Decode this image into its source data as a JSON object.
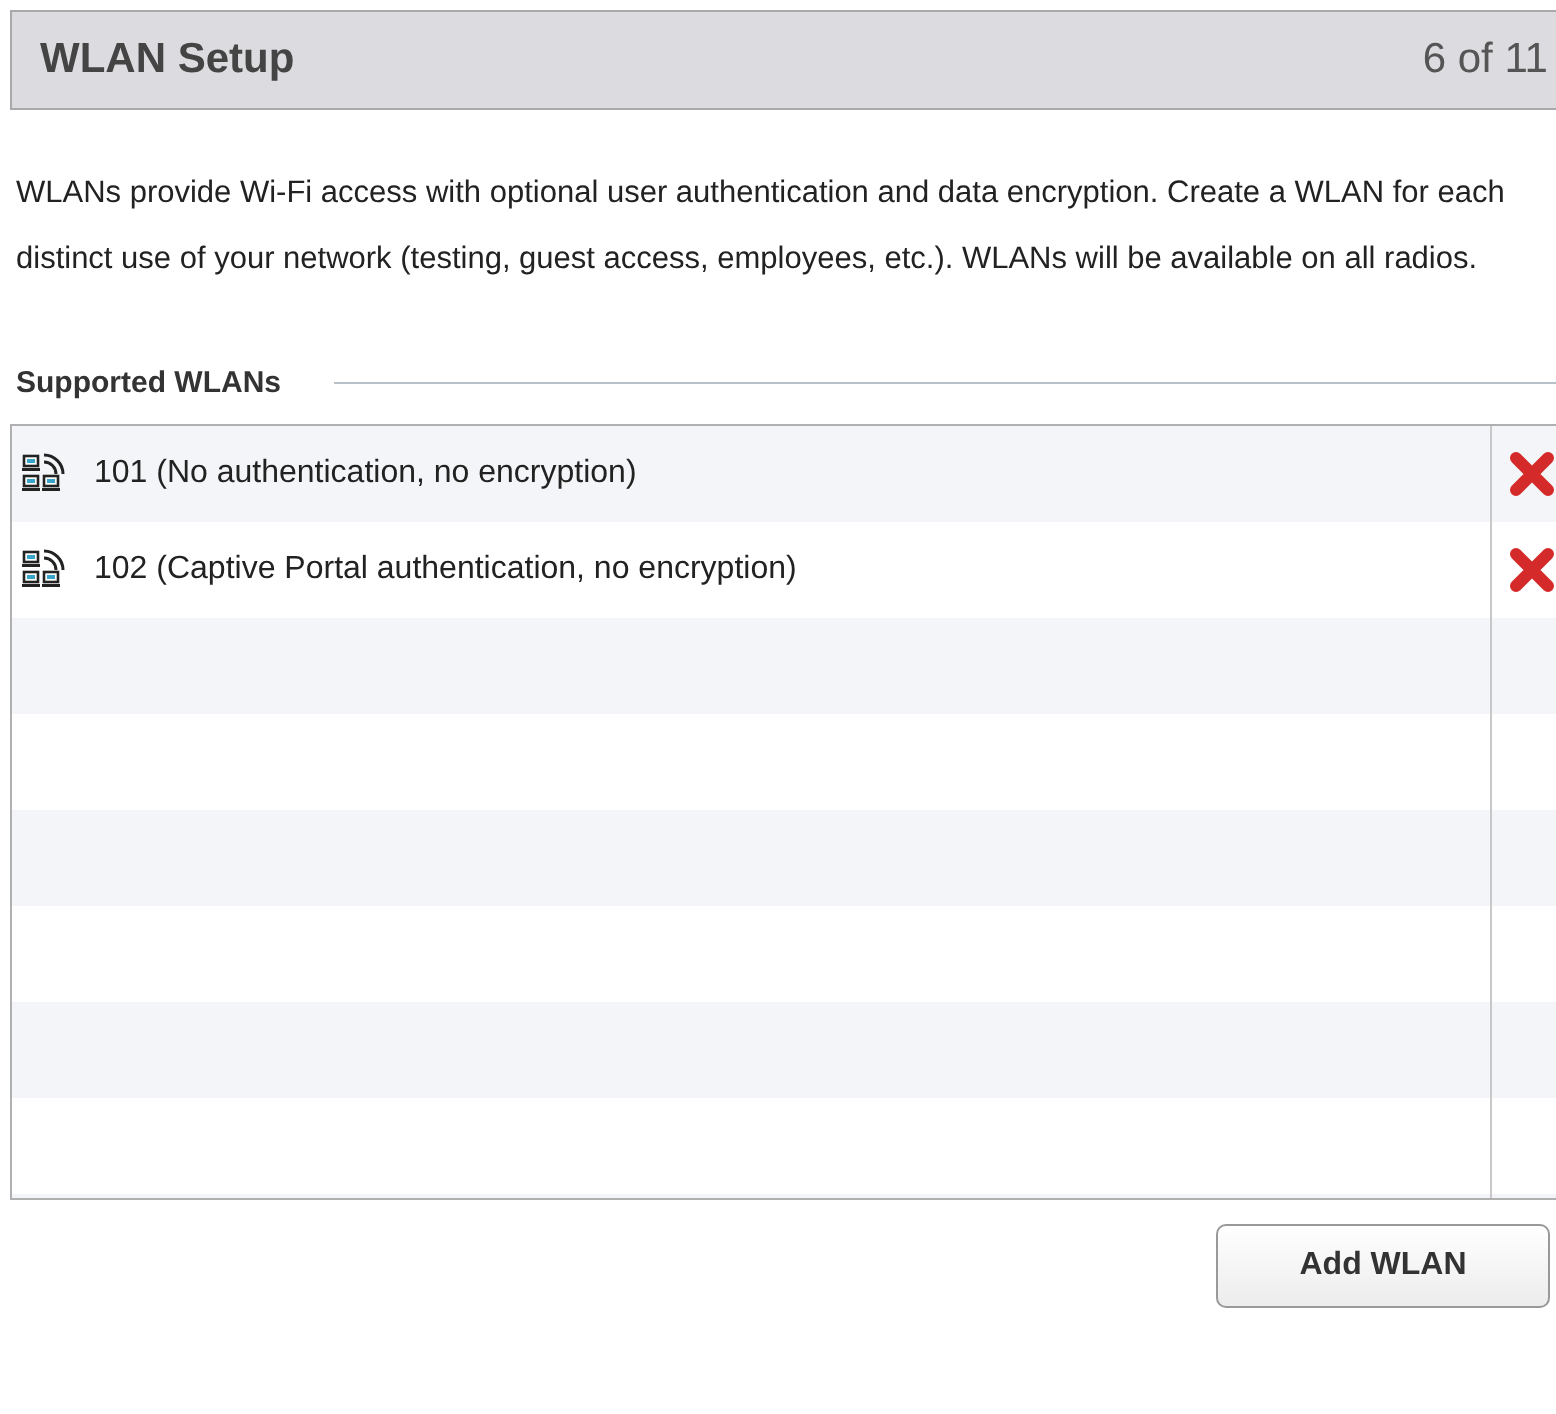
{
  "header": {
    "title": "WLAN Setup",
    "step": "6 of 11"
  },
  "description": "WLANs provide Wi-Fi access with optional user authentication and data encryption.  Create a WLAN for each distinct use of your network (testing, guest access, employees, etc.).  WLANs will be available on all radios.",
  "section": {
    "title": "Supported WLANs"
  },
  "wlans": [
    {
      "label": "101 (No authentication, no encryption)"
    },
    {
      "label": "102 (Captive Portal authentication, no encryption)"
    }
  ],
  "buttons": [
    "Add WLAN"
  ]
}
